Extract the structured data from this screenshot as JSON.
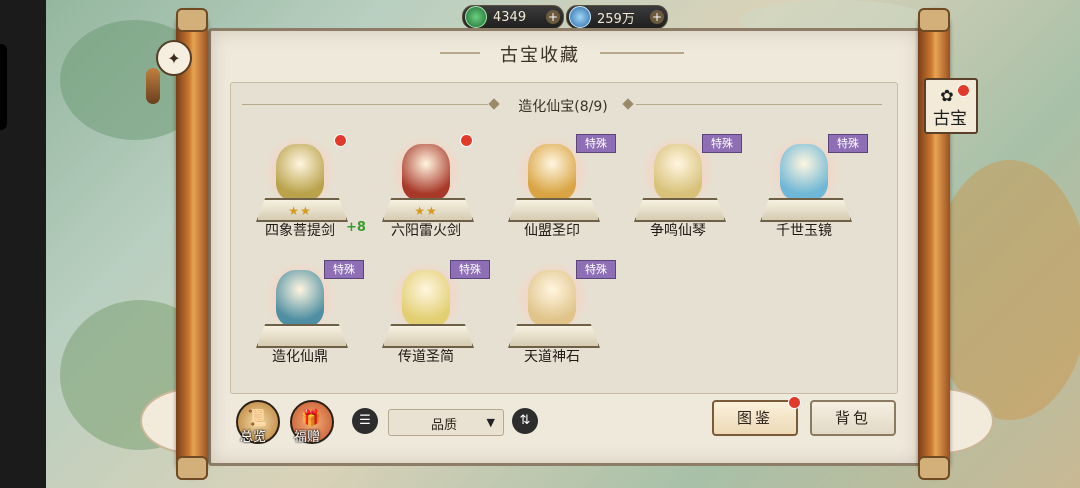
{
  "currency": [
    {
      "icon": "jade-coin-icon",
      "value": "4349",
      "plus": "+"
    },
    {
      "icon": "spirit-crystal-icon",
      "value": "259万",
      "plus": "+"
    }
  ],
  "panel": {
    "title": "古宝收藏",
    "section_title": "造化仙宝(8/9)",
    "special_label": "特殊",
    "star_glyph": "★★"
  },
  "side_tab": {
    "label": "古宝",
    "icon": "treasure-icon"
  },
  "items": [
    {
      "name": "四象菩提剑",
      "stars": 2,
      "bonus": "+8",
      "special": false,
      "red_dot": true,
      "art_color": "#b9a24a"
    },
    {
      "name": "六阳雷火剑",
      "stars": 2,
      "bonus": "",
      "special": false,
      "red_dot": true,
      "art_color": "#a8392a"
    },
    {
      "name": "仙盟圣印",
      "stars": 0,
      "bonus": "",
      "special": true,
      "red_dot": false,
      "art_color": "#d9a443"
    },
    {
      "name": "争鸣仙琴",
      "stars": 0,
      "bonus": "",
      "special": true,
      "red_dot": false,
      "art_color": "#d8c27a"
    },
    {
      "name": "千世玉镜",
      "stars": 0,
      "bonus": "",
      "special": true,
      "red_dot": false,
      "art_color": "#6fb7d6"
    },
    {
      "name": "造化仙鼎",
      "stars": 0,
      "bonus": "",
      "special": true,
      "red_dot": false,
      "art_color": "#4f8fa2"
    },
    {
      "name": "传道圣简",
      "stars": 0,
      "bonus": "",
      "special": true,
      "red_dot": false,
      "art_color": "#e2cf72"
    },
    {
      "name": "天道神石",
      "stars": 0,
      "bonus": "",
      "special": true,
      "red_dot": false,
      "art_color": "#e0c48a"
    }
  ],
  "bottom": {
    "overview_label": "总览",
    "gift_label": "福赠",
    "sort_select_value": "品质",
    "atlas_button": "图鉴",
    "bag_button": "背包"
  },
  "colors": {
    "accent": "#8e6fb5",
    "alert": "#e23a2a",
    "bonus": "#3b9c2e"
  }
}
